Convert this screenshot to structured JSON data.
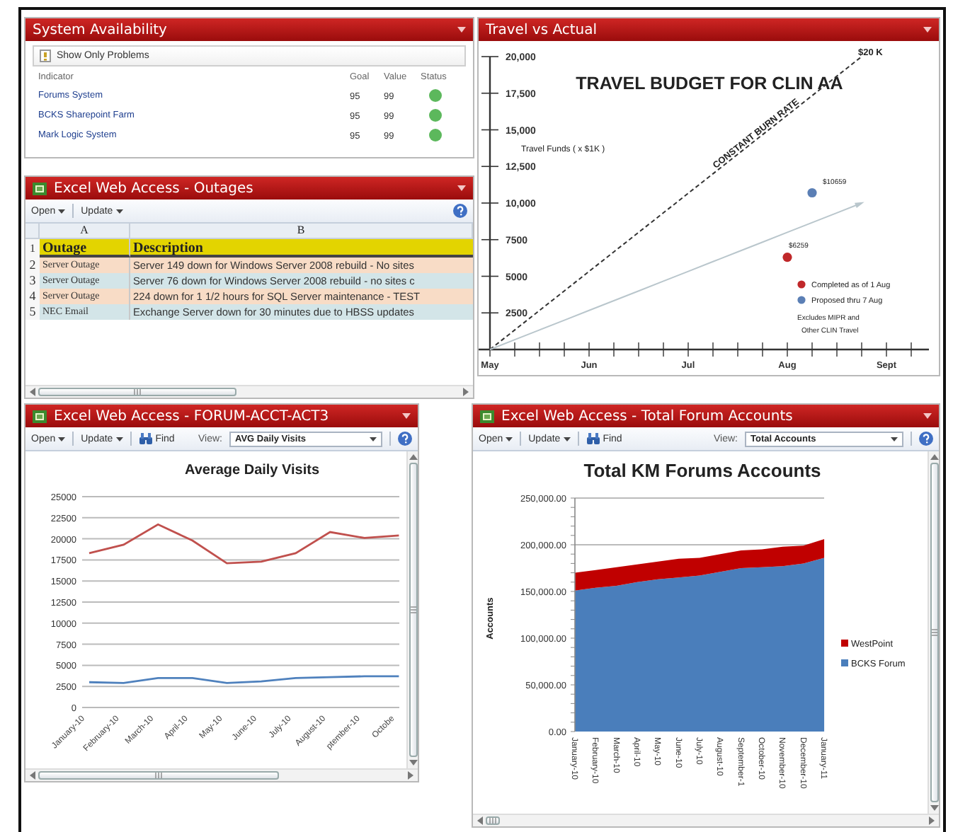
{
  "system_availability": {
    "title": "System Availability",
    "filter_button": "Show Only Problems",
    "columns": [
      "Indicator",
      "Goal",
      "Value",
      "Status"
    ],
    "rows": [
      {
        "indicator": "Forums System",
        "goal": "95",
        "value": "99",
        "color": "#5cb85c"
      },
      {
        "indicator": "BCKS Sharepoint Farm",
        "goal": "95",
        "value": "99",
        "color": "#5cb85c"
      },
      {
        "indicator": "Mark Logic System",
        "goal": "95",
        "value": "99",
        "color": "#5cb85c"
      }
    ]
  },
  "outages": {
    "title": "Excel Web Access - Outages",
    "toolbar": [
      {
        "label": "Open",
        "kind": "menu"
      },
      {
        "label": "Update",
        "kind": "menu"
      }
    ],
    "column_headers": [
      "A",
      "B"
    ],
    "rows": [
      {
        "number": "1",
        "kind": "header",
        "color": "#e3d400",
        "cells": [
          "Outage",
          "Description"
        ]
      },
      {
        "number": "2",
        "kind": "data",
        "color": "#f8dcc6",
        "cells": [
          "Server Outage",
          "Server 149 down for Windows Server 2008 rebuild - No sites"
        ]
      },
      {
        "number": "3",
        "kind": "data",
        "color": "#d3e5e8",
        "cells": [
          "Server Outage",
          "Server 76 down for Windows Server 2008 rebuild - no sites c"
        ]
      },
      {
        "number": "4",
        "kind": "data",
        "color": "#f8dcc6",
        "cells": [
          "Server Outage",
          "224 down for 1 1/2 hours for SQL Server maintenance - TEST"
        ]
      },
      {
        "number": "5",
        "kind": "data",
        "color": "#d3e5e8",
        "cells": [
          "NEC Email",
          "Exchange Server down for 30 minutes due to HBSS updates"
        ]
      }
    ]
  },
  "travel": {
    "title": "Travel vs Actual",
    "chart_data": {
      "type": "scatter",
      "legend": "right",
      "title": "TRAVEL BUDGET FOR CLIN AA",
      "ylabel": "Travel Funds ( x $1K )",
      "ylim": [
        0,
        20000
      ],
      "categories": [
        "May",
        null,
        null,
        null,
        "Jun",
        null,
        null,
        null,
        "Jul",
        null,
        null,
        null,
        "Aug",
        null,
        null,
        null,
        "Sept"
      ],
      "yticks": [
        {
          "value": 2500,
          "label": "2500"
        },
        {
          "value": 5000,
          "label": "5000"
        },
        {
          "value": 7500,
          "label": "7500"
        },
        {
          "value": 10000,
          "label": "10,000"
        },
        {
          "value": 12500,
          "label": "12,500"
        },
        {
          "value": 15000,
          "label": "15,000"
        },
        {
          "value": 17500,
          "label": "17,500"
        },
        {
          "value": 20000,
          "label": "20,000"
        }
      ],
      "series": [
        {
          "name": "Completed as of 1 Aug",
          "color": "#c0282a",
          "values": [
            null,
            null,
            null,
            null,
            null,
            null,
            null,
            null,
            null,
            null,
            null,
            null,
            6300,
            null,
            null,
            null,
            null
          ]
        },
        {
          "name": "Proposed thru 7 Aug",
          "color": "#5b7fb5",
          "values": [
            null,
            null,
            null,
            null,
            null,
            null,
            null,
            null,
            null,
            null,
            null,
            null,
            null,
            10700,
            null,
            null,
            null
          ]
        },
        {
          "name": "CONSTANT BURN RATE",
          "type": "line",
          "line_style": "dashed",
          "color": "#333333",
          "values": [
            0,
            1333,
            2667,
            4000,
            5333,
            6667,
            8000,
            9333,
            10667,
            12000,
            13333,
            14667,
            16000,
            17333,
            18667,
            20000,
            null
          ]
        },
        {
          "type": "line",
          "color": "#b9c6cc",
          "values": [
            0,
            667,
            1333,
            2000,
            2667,
            3333,
            4000,
            4667,
            5333,
            6000,
            6667,
            7333,
            8000,
            8667,
            9333,
            10000,
            null
          ]
        }
      ],
      "annotations": [
        "$20 K",
        "$6259",
        "$10659",
        "Excludes MIPR and",
        "Other CLIN Travel"
      ]
    }
  },
  "daily_visits": {
    "title": "Excel Web Access - FORUM-ACCT-ACT3",
    "toolbar": [
      {
        "label": "Open",
        "kind": "menu"
      },
      {
        "label": "Update",
        "kind": "menu"
      },
      {
        "label": "Find",
        "kind": "find"
      },
      {
        "label": "View:",
        "kind": "view",
        "value": "AVG Daily Visits"
      }
    ],
    "chart_data": {
      "type": "line",
      "grid": true,
      "title": "Average Daily Visits",
      "categories": [
        "January-10",
        "February-10",
        "March-10",
        "April-10",
        "May-10",
        "June-10",
        "July-10",
        "August-10",
        "ptember-10",
        "Octobe"
      ],
      "ylim": [
        0,
        25000
      ],
      "yticks": [
        0,
        2500,
        5000,
        7500,
        10000,
        12500,
        15000,
        17500,
        20000,
        22500,
        25000
      ],
      "series": [
        {
          "color": "#c0504d",
          "values": [
            18300,
            19300,
            21700,
            19800,
            17100,
            17300,
            18300,
            20800,
            20100,
            20400
          ]
        },
        {
          "color": "#4f81bd",
          "values": [
            3000,
            2900,
            3500,
            3500,
            2900,
            3100,
            3500,
            3600,
            3700,
            3700
          ]
        }
      ]
    }
  },
  "forum_accounts": {
    "title": "Excel Web Access - Total Forum Accounts",
    "toolbar": [
      {
        "label": "Open",
        "kind": "menu"
      },
      {
        "label": "Update",
        "kind": "menu"
      },
      {
        "label": "Find",
        "kind": "find"
      },
      {
        "label": "View:",
        "kind": "view",
        "value": "Total Accounts"
      }
    ],
    "chart_data": {
      "type": "area",
      "stacked": true,
      "legend": "right",
      "title": "Total KM Forums Accounts",
      "ylabel": "Accounts",
      "categories": [
        "January-10",
        "February-10",
        "March-10",
        "April-10",
        "May-10",
        "June-10",
        "July-10",
        "August-10",
        "September-1",
        "October-10",
        "November-10",
        "December-10",
        "January-11"
      ],
      "ylim": [
        0,
        250000
      ],
      "yticks": [
        {
          "value": 0,
          "label": "0.00"
        },
        {
          "value": 50000,
          "label": "50,000.00"
        },
        {
          "value": 100000,
          "label": "100,000.00"
        },
        {
          "value": 150000,
          "label": "150,000.00"
        },
        {
          "value": 200000,
          "label": "200,000.00"
        },
        {
          "value": 250000,
          "label": "250,000.00"
        }
      ],
      "series": [
        {
          "name": "BCKS Forum",
          "color": "#4a7ebb",
          "values": [
            151000,
            154000,
            156000,
            160000,
            163000,
            165000,
            167000,
            171000,
            175000,
            176000,
            177000,
            180000,
            186000
          ]
        },
        {
          "name": "WestPoint",
          "color": "#c00000",
          "values": [
            19000,
            19000,
            20000,
            19000,
            19000,
            20000,
            19000,
            19000,
            19000,
            19000,
            21000,
            19000,
            20000
          ]
        }
      ]
    }
  }
}
